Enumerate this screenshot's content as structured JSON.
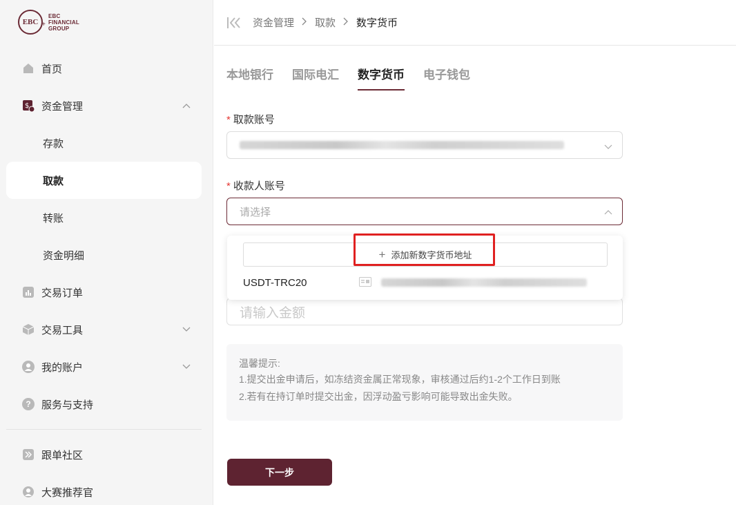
{
  "brand": {
    "logo_mark": "EBC",
    "logo_lines": [
      "EBC",
      "FINANCIAL",
      "GROUP"
    ]
  },
  "sidebar": {
    "items": [
      {
        "label": "首页",
        "icon": "home-icon"
      },
      {
        "label": "资金管理",
        "icon": "funds-icon",
        "expanded": true
      },
      {
        "label": "交易订单",
        "icon": "bar-chart-icon"
      },
      {
        "label": "交易工具",
        "icon": "cube-icon"
      },
      {
        "label": "我的账户",
        "icon": "user-icon"
      },
      {
        "label": "服务与支持",
        "icon": "help-icon"
      },
      {
        "label": "跟单社区",
        "icon": "follow-icon"
      },
      {
        "label": "大赛推荐官",
        "icon": "contest-user-icon"
      }
    ],
    "sub_items": [
      {
        "label": "存款"
      },
      {
        "label": "取款",
        "active": true
      },
      {
        "label": "转账"
      },
      {
        "label": "资金明细"
      }
    ]
  },
  "breadcrumb": {
    "items": [
      "资金管理",
      "取款",
      "数字货币"
    ]
  },
  "tabs": [
    {
      "label": "本地银行"
    },
    {
      "label": "国际电汇"
    },
    {
      "label": "数字货币",
      "active": true
    },
    {
      "label": "电子钱包"
    }
  ],
  "form": {
    "account_label": "取款账号",
    "payee_label": "收款人账号",
    "payee_placeholder": "请选择",
    "amount_placeholder": "请输入金额"
  },
  "dropdown": {
    "add_label": "添加新数字货币地址",
    "options": [
      {
        "name": "USDT-TRC20"
      }
    ]
  },
  "tips": {
    "title": "温馨提示:",
    "lines": [
      "1.提交出金申请后，如冻结资金属正常现象，审核通过后约1-2个工作日到账",
      "2.若有在持订单时提交出金，因浮动盈亏影响可能导致出金失败。"
    ]
  },
  "actions": {
    "next_label": "下一步"
  },
  "colors": {
    "brand": "#6b2a35",
    "button": "#5e2331",
    "highlight": "#e02020"
  }
}
